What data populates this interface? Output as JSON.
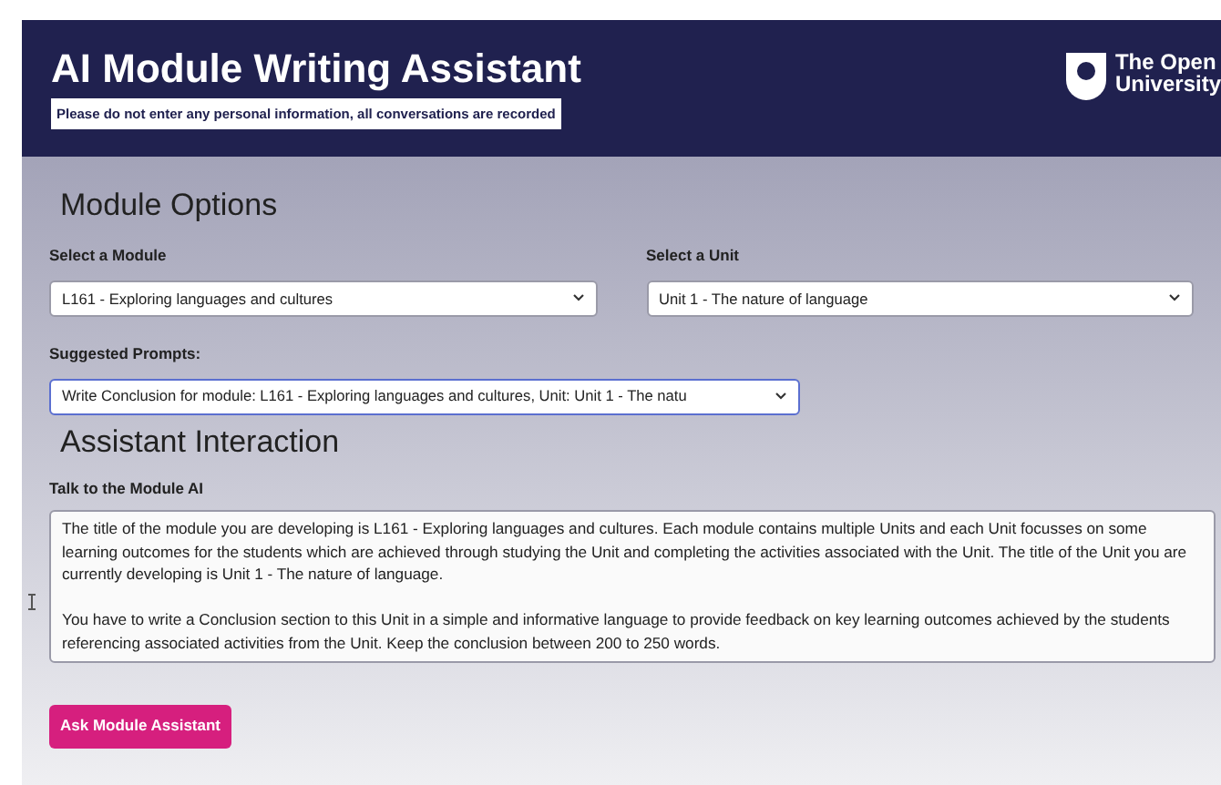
{
  "header": {
    "title": "AI Module Writing Assistant",
    "notice": "Please do not enter any personal information, all conversations are recorded",
    "logo_lines": [
      "The Open",
      "University"
    ]
  },
  "module_options": {
    "heading": "Module Options",
    "selects": [
      {
        "label": "Select a Module",
        "value": "L161 - Exploring languages and cultures",
        "focused": false
      },
      {
        "label": "Select a Unit",
        "value": "Unit 1 - The nature of language",
        "focused": false
      }
    ],
    "prompt": {
      "label": "Suggested Prompts:",
      "value": "Write Conclusion for module: L161 - Exploring languages and cultures, Unit: Unit 1 - The natu",
      "focused": true
    }
  },
  "assistant": {
    "heading": "Assistant Interaction",
    "label": "Talk to the Module AI",
    "message": "The title of the module you are developing is L161 - Exploring languages and cultures. Each module contains multiple Units and each Unit focusses on some learning outcomes for the students which are achieved through studying the Unit and completing the activities associated with the Unit. The title of the Unit you are currently developing is Unit 1 - The nature of language.\n\nYou have to write a Conclusion section to this Unit in a simple and informative language to provide feedback on key learning outcomes achieved by the students referencing associated activities from the Unit. Keep the conclusion between 200 to 250 words.",
    "button": "Ask Module Assistant"
  }
}
